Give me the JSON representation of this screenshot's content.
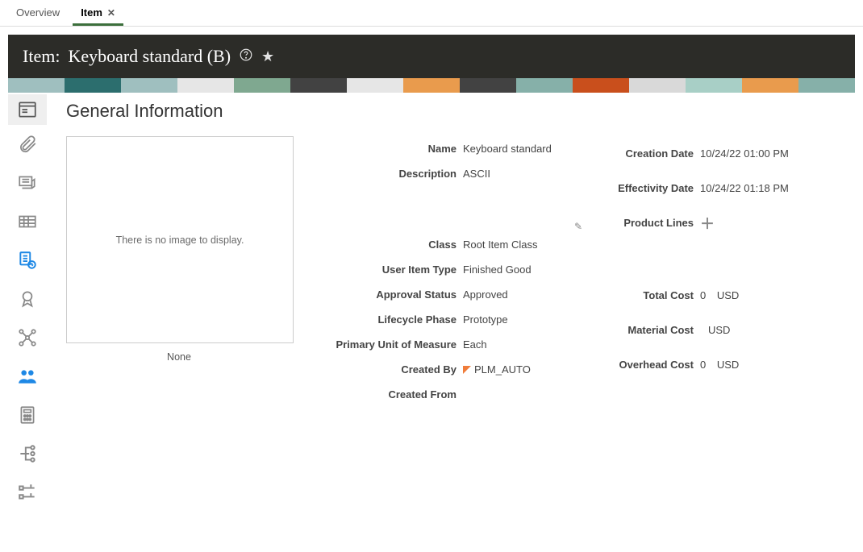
{
  "tabs": {
    "overview": "Overview",
    "item": "Item"
  },
  "title": {
    "prefix": "Item:",
    "name": "Keyboard standard (B)"
  },
  "section_title": "General Information",
  "image_panel": {
    "placeholder": "There is no image to display.",
    "caption": "None"
  },
  "labels": {
    "name": "Name",
    "description": "Description",
    "class": "Class",
    "user_item_type": "User Item Type",
    "approval_status": "Approval Status",
    "lifecycle_phase": "Lifecycle Phase",
    "primary_uom": "Primary Unit of Measure",
    "created_by": "Created By",
    "created_from": "Created From",
    "creation_date": "Creation Date",
    "effectivity_date": "Effectivity Date",
    "product_lines": "Product Lines",
    "total_cost": "Total Cost",
    "material_cost": "Material Cost",
    "overhead_cost": "Overhead Cost"
  },
  "values": {
    "name": "Keyboard standard",
    "description": "ASCII",
    "class": "Root Item Class",
    "user_item_type": "Finished Good",
    "approval_status": "Approved",
    "lifecycle_phase": "Prototype",
    "primary_uom": "Each",
    "created_by": "PLM_AUTO",
    "created_from": "",
    "creation_date": "10/24/22 01:00 PM",
    "effectivity_date": "10/24/22 01:18 PM",
    "total_cost_value": "0",
    "total_cost_currency": "USD",
    "material_cost_value": "",
    "material_cost_currency": "USD",
    "overhead_cost_value": "0",
    "overhead_cost_currency": "USD"
  }
}
